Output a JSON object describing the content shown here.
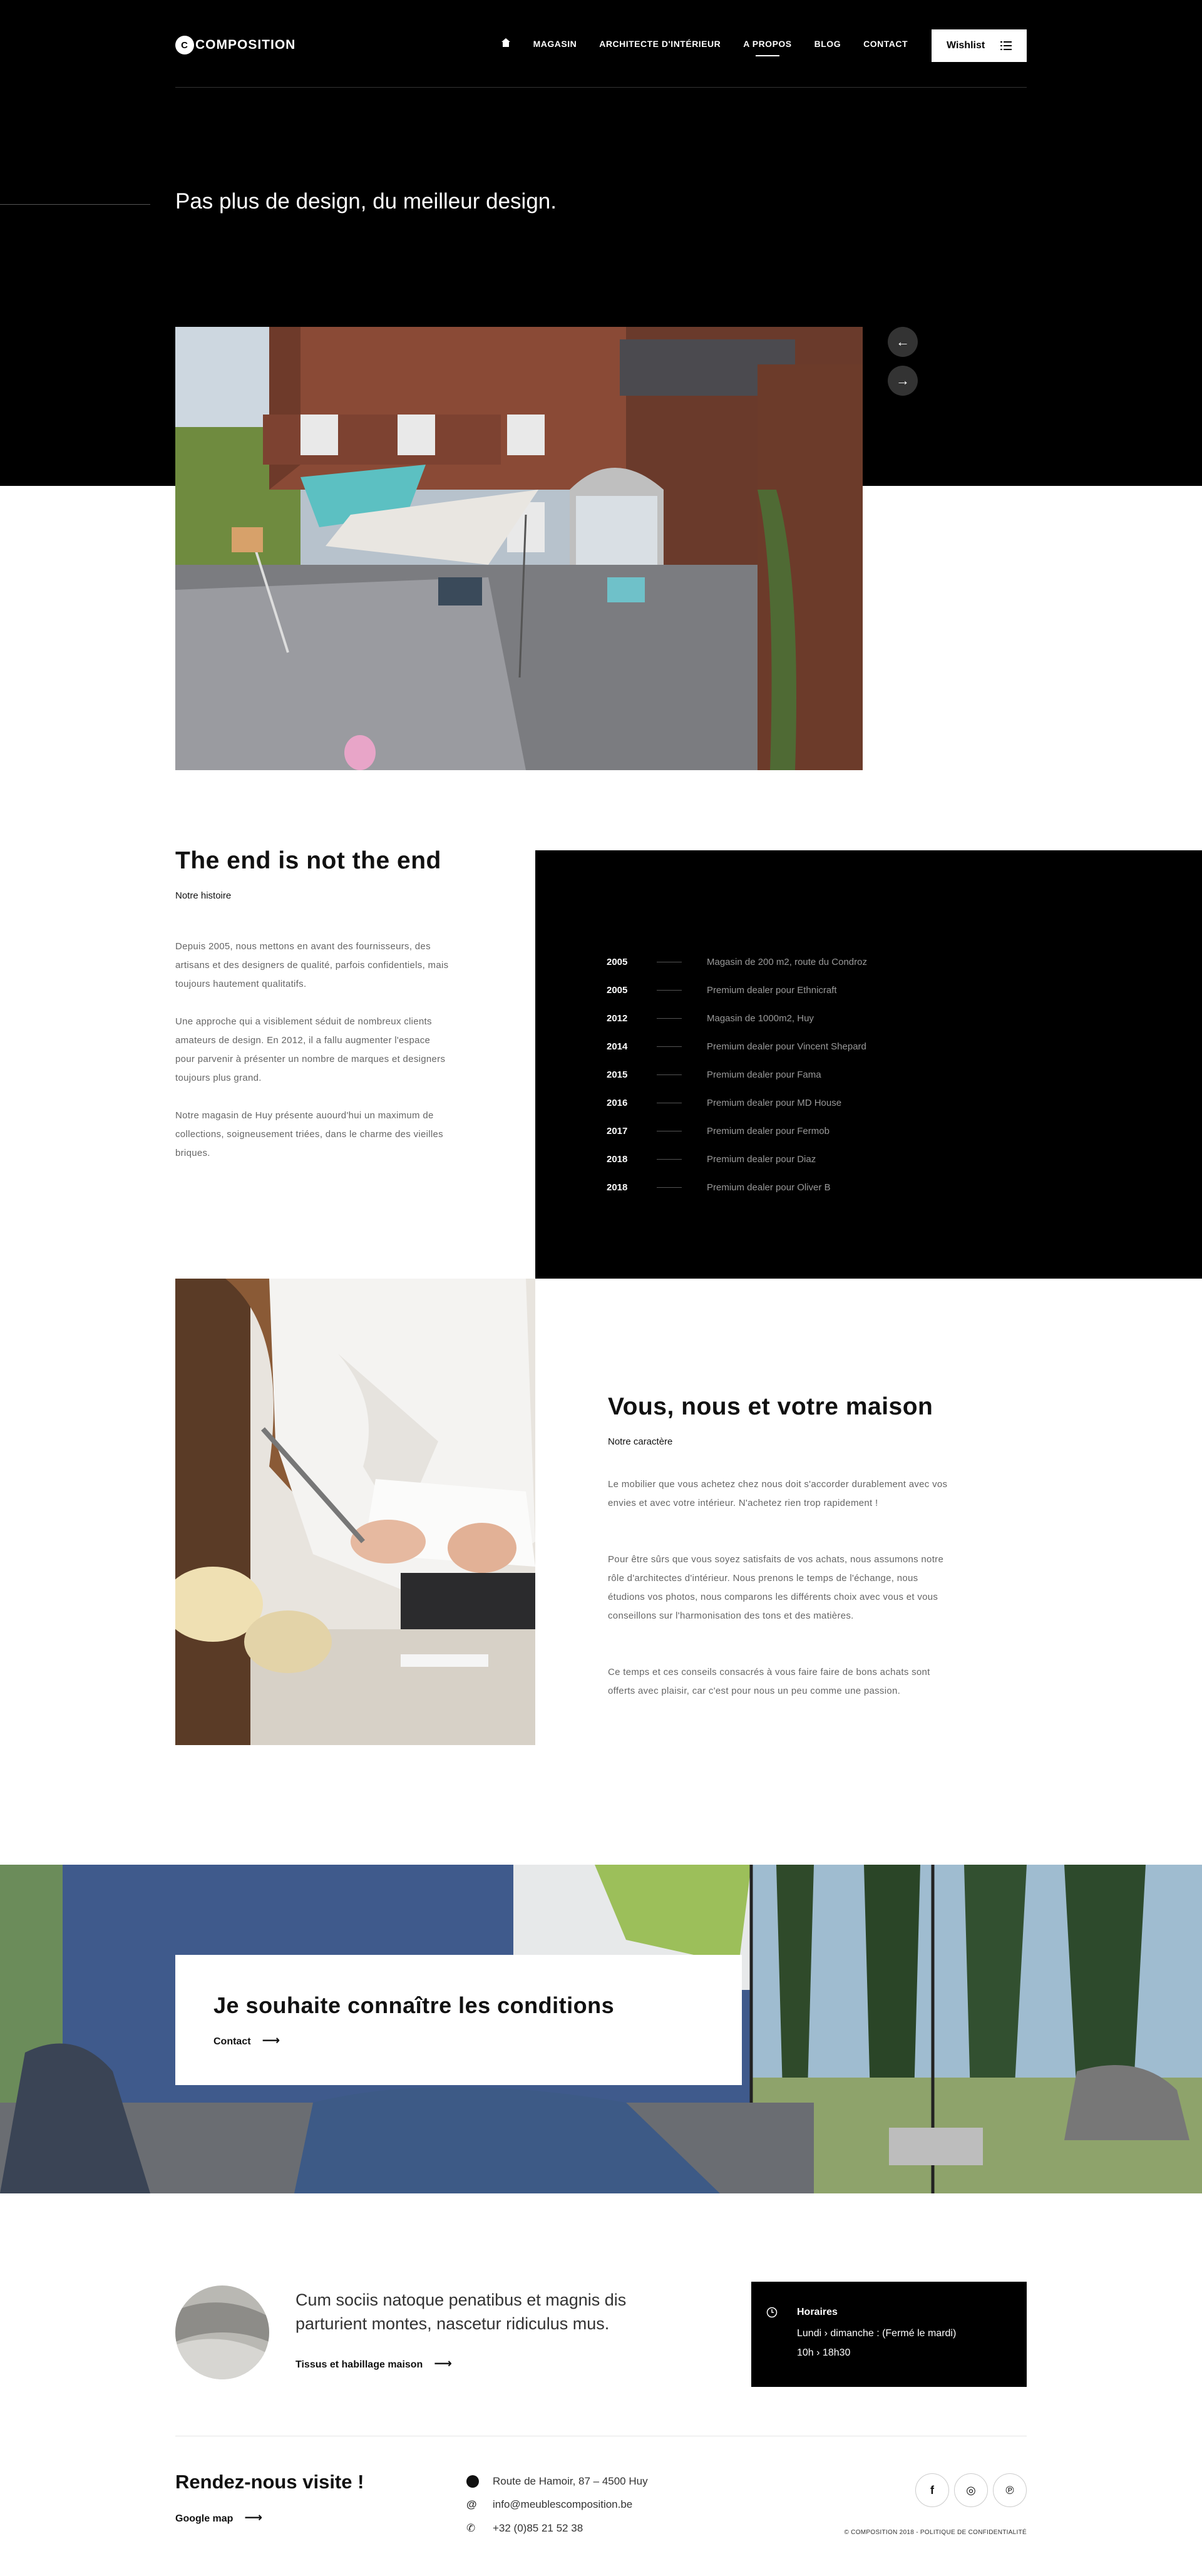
{
  "header": {
    "logo": "COMPOSITION",
    "logo_mark": "C",
    "nav": [
      "MAGASIN",
      "ARCHITECTE D'INTÉRIEUR",
      "A PROPOS",
      "BLOG",
      "CONTACT"
    ],
    "wishlist_label": "Wishlist",
    "tagline": "Pas plus de design, du meilleur design."
  },
  "slider": {
    "prev": "←",
    "next": "→"
  },
  "story": {
    "title": "The end is not the end",
    "subtitle": "Notre histoire",
    "p1": "Depuis 2005, nous mettons en avant des fournisseurs, des artisans et des designers de qualité, parfois confidentiels, mais toujours hautement qualitatifs.",
    "p2": "Une approche qui a visiblement séduit de nombreux clients amateurs de design. En 2012, il a fallu augmenter l'espace pour parvenir à présenter un nombre de marques et designers toujours plus grand.",
    "p3": "Notre magasin de Huy présente auourd'hui un maximum de collections, soigneusement triées, dans le charme des vieilles briques.",
    "timeline": [
      {
        "year": "2005",
        "text": "Magasin de 200 m2, route du Condroz"
      },
      {
        "year": "2005",
        "text": "Premium dealer pour Ethnicraft"
      },
      {
        "year": "2012",
        "text": "Magasin de 1000m2, Huy"
      },
      {
        "year": "2014",
        "text": "Premium dealer pour Vincent Shepard"
      },
      {
        "year": "2015",
        "text": "Premium dealer pour Fama"
      },
      {
        "year": "2016",
        "text": "Premium dealer pour MD House"
      },
      {
        "year": "2017",
        "text": "Premium dealer pour Fermob"
      },
      {
        "year": "2018",
        "text": "Premium dealer pour Diaz"
      },
      {
        "year": "2018",
        "text": "Premium dealer pour Oliver B"
      }
    ]
  },
  "character": {
    "title": "Vous, nous et votre maison",
    "subtitle": "Notre caractère",
    "p1": "Le mobilier que vous achetez chez nous doit s'accorder durablement avec vos envies et avec votre intérieur. N'achetez rien trop rapidement !",
    "p2": "Pour être sûrs que vous soyez satisfaits de vos achats, nous assumons notre rôle d'architectes d'intérieur. Nous prenons le temps de l'échange, nous étudions vos photos, nous comparons les différents choix avec vous et vous conseillons sur l'harmonisation des tons et des matières.",
    "p3": "Ce temps et ces conseils consacrés à vous faire faire de bons achats sont offerts avec plaisir, car c'est pour nous un peu comme une passion."
  },
  "conditions": {
    "title": "Je souhaite connaître les conditions",
    "link": "Contact"
  },
  "promo": {
    "text": "Cum sociis natoque penatibus et magnis dis parturient montes, nascetur ridiculus mus.",
    "link": "Tissus et habillage maison"
  },
  "hours": {
    "title": "Horaires",
    "line1": "Lundi › dimanche :  (Fermé le mardi)",
    "line2": "10h › 18h30"
  },
  "footer": {
    "visit_title": "Rendez-nous visite !",
    "map_link": "Google map",
    "address": "Route de Hamoir, 87 – 4500 Huy",
    "email": "info@meublescomposition.be",
    "phone": "+32 (0)85 21 52 38",
    "copyright": "© COMPOSITION 2018 - POLITIQUE DE CONFIDENTIALITÉ",
    "social": [
      "f",
      "◎",
      "℗"
    ]
  },
  "colors": {
    "bg_dark": "#000000",
    "text": "#111111",
    "muted": "#666666"
  }
}
